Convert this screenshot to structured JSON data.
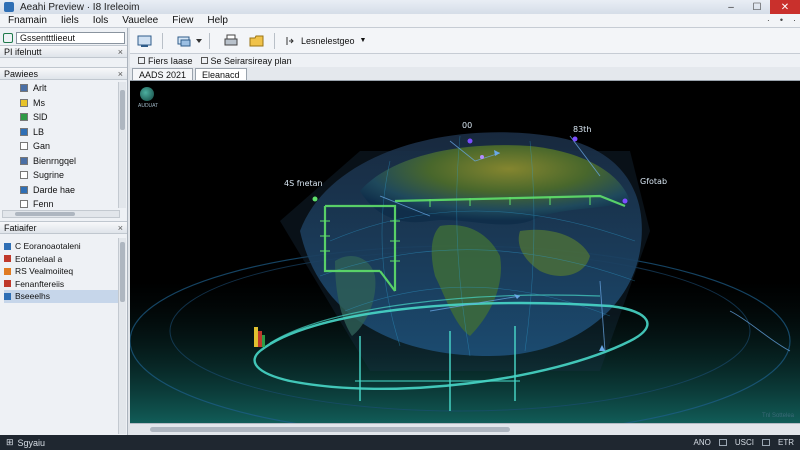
{
  "window": {
    "title": "Aeahi Preview  ·  I8 Ireleoim"
  },
  "menu": {
    "items": [
      "Fnamain",
      "Iiels",
      "Iols",
      "Vauelee",
      "Fiew",
      "Help"
    ],
    "right": [
      "·",
      "•",
      "·"
    ]
  },
  "left_panel": {
    "search_value": "Gssentttlieeut",
    "section_a": {
      "title": "PI ifelnutt",
      "close": "×"
    },
    "section_b": {
      "title": "Pawiees",
      "close": "×"
    },
    "tree": [
      {
        "label": "Arlt",
        "color": "#4a6fa5"
      },
      {
        "label": "Ms",
        "color": "#e8c32a"
      },
      {
        "label": "SlD",
        "color": "#2e9a45"
      },
      {
        "label": "LB",
        "color": "#2f6fb5"
      },
      {
        "label": "Gan",
        "color": "#ffffff"
      },
      {
        "label": "Bienrngqel",
        "color": "#4a6fa5"
      },
      {
        "label": "Sugrine",
        "color": "#ffffff"
      },
      {
        "label": "Darde hae",
        "color": "#2f6fb5"
      },
      {
        "label": "Fenn",
        "color": "#ffffff"
      }
    ],
    "section_c": {
      "title": "Fatiaifer",
      "close": "×"
    },
    "layers": [
      {
        "label": "C Eoranoaotaleni",
        "color": "#2f6fb5",
        "selected": false
      },
      {
        "label": "Eotanelaal a",
        "color": "#c0392b",
        "selected": false
      },
      {
        "label": "RS Vealmoiiteq",
        "color": "#e07b22",
        "selected": false
      },
      {
        "label": "Fenanftereiis",
        "color": "#c0392b",
        "selected": false
      },
      {
        "label": "Bseeelhs",
        "color": "#2f6fb5",
        "selected": true
      }
    ]
  },
  "toolbar": {
    "combo": "Lesnelestgeo",
    "combo_arrow": "▼"
  },
  "subbar": {
    "items": [
      "Fiers Iaase",
      "Se Seirarsireay plan"
    ]
  },
  "tabs": [
    {
      "label": "AADS 2021",
      "active": false
    },
    {
      "label": "Eleanacd",
      "active": true
    }
  ],
  "viewport": {
    "labels": {
      "top_a": "00",
      "top_b": "83th",
      "left": "4S fnetan",
      "right": "Gfotab"
    },
    "compass_caption": "AUDUAT",
    "watermark": "Tnl Sottelea",
    "colors": {
      "background": "#000000",
      "globe_land": "#6e7a2a",
      "globe_ocean": "#1c3b64",
      "orbit": "#48d7c8",
      "grid": "#2fa3d6"
    }
  },
  "status": {
    "left": "Sgyaiu",
    "right": [
      "ANO",
      "USCI",
      "ETR"
    ]
  }
}
